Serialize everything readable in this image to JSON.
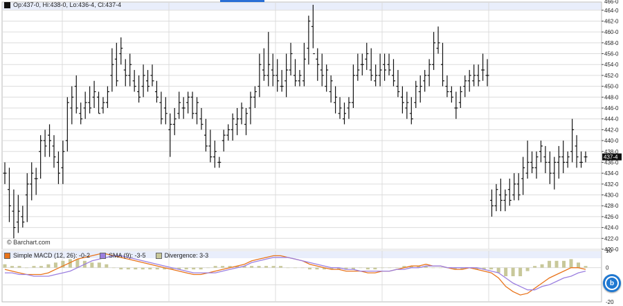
{
  "price_legend": {
    "text": "Op:437-0, Hi:438-0, Lo:436-4, Cl:437-4"
  },
  "watermark": "© Barchart.com",
  "last_price_label": "437-4",
  "macd_legend": {
    "macd": {
      "label": "Simple MACD (12, 26): -0-2",
      "color": "#e8731a"
    },
    "sma": {
      "label": "SMA (9): -3-5",
      "color": "#9b7fe0"
    },
    "divergence": {
      "label": "Divergence: 3-3",
      "color": "#c8c89a"
    }
  },
  "button_icon": "barchart-b-icon",
  "colors": {
    "bar": "#111111",
    "grid": "#dcdcdc",
    "axis_label_bg": "#111111"
  },
  "chart_data": [
    {
      "type": "ohlc",
      "title": "",
      "xlabel": "",
      "ylabel": "",
      "ylim": [
        420,
        465.5
      ],
      "y_tick_values": [
        420,
        422,
        424,
        426,
        428,
        430,
        432,
        434,
        436,
        438,
        440,
        442,
        444,
        446,
        448,
        450,
        452,
        454,
        456,
        458,
        460,
        462,
        464
      ],
      "y_tick_labels": [
        "420-0",
        "422-0",
        "424-0",
        "426-0",
        "428-0",
        "430-0",
        "432-0",
        "434-0",
        "436-0",
        "438-0",
        "440-0",
        "442-0",
        "444-0",
        "446-0",
        "448-0",
        "450-0",
        "452-0",
        "454-0",
        "456-0",
        "458-0",
        "460-0",
        "462-0",
        "464-0"
      ],
      "grid": true,
      "bars": [
        [
          434,
          436,
          432,
          434
        ],
        [
          431,
          435,
          425,
          428
        ],
        [
          427,
          431,
          422,
          424
        ],
        [
          425,
          430,
          423,
          427
        ],
        [
          426,
          428,
          424,
          425
        ],
        [
          430,
          434,
          425,
          432
        ],
        [
          432,
          436,
          429,
          434
        ],
        [
          433,
          435,
          430,
          433
        ],
        [
          438,
          441,
          433,
          440
        ],
        [
          440,
          442,
          437,
          439
        ],
        [
          441,
          443,
          437,
          440
        ],
        [
          439,
          441,
          435,
          437
        ],
        [
          436,
          438,
          432,
          434
        ],
        [
          435,
          440,
          432,
          438
        ],
        [
          440,
          448,
          438,
          447
        ],
        [
          446,
          450,
          443,
          448
        ],
        [
          450,
          452,
          445,
          446
        ],
        [
          445,
          447,
          443,
          444
        ],
        [
          446,
          449,
          444,
          447
        ],
        [
          447,
          450,
          445,
          446
        ],
        [
          448,
          451,
          446,
          449
        ],
        [
          448,
          449,
          445,
          445
        ],
        [
          446,
          448,
          445,
          447
        ],
        [
          447,
          450,
          446,
          449
        ],
        [
          452,
          457,
          449,
          454
        ],
        [
          455,
          458,
          450,
          451
        ],
        [
          456,
          459,
          454,
          457
        ],
        [
          453,
          455,
          450,
          452
        ],
        [
          452,
          456,
          450,
          454
        ],
        [
          451,
          453,
          449,
          450
        ],
        [
          449,
          452,
          447,
          448
        ],
        [
          450,
          454,
          448,
          452
        ],
        [
          451,
          453,
          449,
          450
        ],
        [
          452,
          454,
          450,
          451
        ],
        [
          449,
          451,
          447,
          448
        ],
        [
          447,
          449,
          443,
          444
        ],
        [
          446,
          448,
          443,
          445
        ],
        [
          442,
          445,
          437,
          443
        ],
        [
          443,
          446,
          441,
          444
        ],
        [
          445,
          449,
          444,
          447
        ],
        [
          446,
          448,
          444,
          446
        ],
        [
          447,
          449,
          445,
          448
        ],
        [
          448,
          449,
          444,
          445
        ],
        [
          445,
          448,
          443,
          447
        ],
        [
          444,
          446,
          442,
          443
        ],
        [
          441,
          444,
          438,
          439
        ],
        [
          439,
          442,
          436,
          437
        ],
        [
          437,
          440,
          435,
          438
        ],
        [
          436,
          437,
          435,
          436
        ],
        [
          440,
          442,
          438,
          441
        ],
        [
          441,
          443,
          440,
          442
        ],
        [
          442,
          445,
          440,
          444
        ],
        [
          443,
          446,
          441,
          444
        ],
        [
          444,
          447,
          443,
          446
        ],
        [
          443,
          446,
          441,
          445
        ],
        [
          446,
          449,
          443,
          448
        ],
        [
          448,
          450,
          446,
          449
        ],
        [
          450,
          456,
          448,
          454
        ],
        [
          453,
          457,
          451,
          452
        ],
        [
          452,
          460,
          450,
          454
        ],
        [
          453,
          456,
          450,
          452
        ],
        [
          452,
          455,
          449,
          451
        ],
        [
          450,
          453,
          449,
          450
        ],
        [
          451,
          456,
          448,
          453
        ],
        [
          453,
          458,
          452,
          456
        ],
        [
          452,
          455,
          450,
          451
        ],
        [
          451,
          453,
          450,
          452
        ],
        [
          451,
          458,
          450,
          455
        ],
        [
          457,
          463,
          454,
          462
        ],
        [
          461,
          465,
          457,
          456
        ],
        [
          455,
          457,
          451,
          454
        ],
        [
          453,
          456,
          450,
          452
        ],
        [
          450,
          454,
          449,
          453
        ],
        [
          449,
          452,
          447,
          451
        ],
        [
          447,
          450,
          445,
          448
        ],
        [
          445,
          448,
          444,
          446
        ],
        [
          444,
          447,
          443,
          445
        ],
        [
          446,
          448,
          444,
          447
        ],
        [
          447,
          454,
          446,
          452
        ],
        [
          452,
          456,
          451,
          453
        ],
        [
          454,
          456,
          452,
          454
        ],
        [
          455,
          458,
          453,
          456
        ],
        [
          453,
          457,
          451,
          452
        ],
        [
          451,
          454,
          450,
          452
        ],
        [
          452,
          456,
          450,
          453
        ],
        [
          454,
          456,
          451,
          453
        ],
        [
          454,
          456,
          452,
          453
        ],
        [
          452,
          455,
          450,
          451
        ],
        [
          450,
          453,
          448,
          449
        ],
        [
          448,
          450,
          445,
          447
        ],
        [
          446,
          449,
          444,
          447
        ],
        [
          445,
          448,
          443,
          444
        ],
        [
          447,
          451,
          446,
          450
        ],
        [
          449,
          452,
          447,
          450
        ],
        [
          451,
          453,
          449,
          452
        ],
        [
          452,
          455,
          450,
          454
        ],
        [
          454,
          460,
          453,
          458
        ],
        [
          457,
          461,
          456,
          458
        ],
        [
          454,
          458,
          450,
          451
        ],
        [
          450,
          452,
          448,
          449
        ],
        [
          449,
          450,
          447,
          448
        ],
        [
          446,
          449,
          444,
          446
        ],
        [
          447,
          450,
          446,
          449
        ],
        [
          450,
          452,
          448,
          451
        ],
        [
          451,
          453,
          449,
          452
        ],
        [
          451,
          454,
          450,
          452
        ],
        [
          452,
          454,
          450,
          451
        ],
        [
          453,
          456,
          451,
          453
        ],
        [
          452,
          455,
          450,
          452
        ],
        [
          429,
          431,
          426,
          428
        ],
        [
          428,
          432,
          427,
          431
        ],
        [
          430,
          433,
          427,
          429
        ],
        [
          429,
          431,
          427,
          430
        ],
        [
          431,
          433,
          428,
          429
        ],
        [
          430,
          434,
          429,
          432
        ],
        [
          432,
          434,
          429,
          430
        ],
        [
          433,
          437,
          430,
          435
        ],
        [
          434,
          440,
          433,
          436
        ],
        [
          436,
          438,
          434,
          435
        ],
        [
          435,
          438,
          433,
          437
        ],
        [
          438,
          440,
          436,
          439
        ],
        [
          437,
          439,
          434,
          436
        ],
        [
          436,
          438,
          432,
          434
        ],
        [
          434,
          437,
          431,
          436
        ],
        [
          436,
          439,
          433,
          437
        ],
        [
          437,
          440,
          434,
          436
        ],
        [
          436,
          438,
          435,
          437
        ],
        [
          438,
          444,
          436,
          442
        ],
        [
          439,
          441,
          435,
          437
        ],
        [
          436,
          438,
          435,
          436
        ],
        [
          437,
          438,
          436,
          437
        ]
      ]
    },
    {
      "type": "line",
      "title": "",
      "ylim": [
        -20,
        10
      ],
      "y_tick_values": [
        10,
        0,
        -10,
        -20
      ],
      "y_tick_labels": [
        "10",
        "0",
        "-10",
        "-20"
      ],
      "series": [
        {
          "name": "Simple MACD (12, 26)",
          "color": "#e8731a",
          "values": [
            -1,
            -2,
            -3,
            -4,
            -4,
            -4,
            -3,
            -1,
            1,
            3,
            5,
            6,
            7,
            8,
            8,
            7,
            6,
            5,
            4,
            3,
            2,
            1,
            0,
            -1,
            -2,
            -3,
            -4,
            -4,
            -3,
            -2,
            -1,
            0,
            1,
            2,
            4,
            5,
            6,
            7,
            7,
            6,
            5,
            4,
            2,
            1,
            0,
            -1,
            -1,
            -2,
            -2,
            -2,
            -3,
            -3,
            -2,
            -2,
            -1,
            0,
            1,
            1,
            2,
            1,
            1,
            0,
            -1,
            -1,
            0,
            -1,
            -2,
            -3,
            -6,
            -11,
            -14,
            -16,
            -15,
            -12,
            -9,
            -6,
            -4,
            -2,
            0,
            0,
            -1
          ]
        },
        {
          "name": "SMA (9)",
          "color": "#9b7fe0",
          "values": [
            -3,
            -3,
            -4,
            -4,
            -5,
            -5,
            -5,
            -4,
            -3,
            -2,
            0,
            2,
            4,
            5,
            6,
            7,
            7,
            6,
            5,
            4,
            3,
            2,
            1,
            0,
            -1,
            -2,
            -3,
            -3,
            -3,
            -3,
            -2,
            -1,
            0,
            1,
            3,
            4,
            5,
            6,
            6,
            6,
            5,
            4,
            3,
            2,
            1,
            0,
            0,
            -1,
            -1,
            -2,
            -2,
            -2,
            -2,
            -2,
            -1,
            -1,
            0,
            0,
            1,
            1,
            1,
            0,
            0,
            0,
            0,
            0,
            -1,
            -2,
            -3,
            -6,
            -9,
            -11,
            -13,
            -13,
            -11,
            -10,
            -8,
            -6,
            -5,
            -3,
            -2
          ]
        },
        {
          "name": "Divergence",
          "color": "#c8c89a",
          "style": "histogram",
          "values": [
            2,
            1,
            1,
            0,
            1,
            1,
            2,
            3,
            4,
            5,
            5,
            4,
            3,
            3,
            2,
            0,
            -1,
            -1,
            -1,
            -1,
            -1,
            -1,
            -1,
            -1,
            -1,
            -1,
            -1,
            -1,
            0,
            1,
            1,
            1,
            1,
            1,
            1,
            1,
            1,
            1,
            1,
            0,
            0,
            0,
            -1,
            -1,
            -1,
            -1,
            -1,
            -1,
            -1,
            0,
            -1,
            -1,
            0,
            0,
            0,
            1,
            1,
            1,
            1,
            0,
            0,
            0,
            -1,
            -1,
            0,
            -1,
            -1,
            -1,
            -3,
            -5,
            -5,
            -5,
            -2,
            1,
            2,
            4,
            4,
            4,
            5,
            3,
            1
          ]
        }
      ]
    }
  ]
}
